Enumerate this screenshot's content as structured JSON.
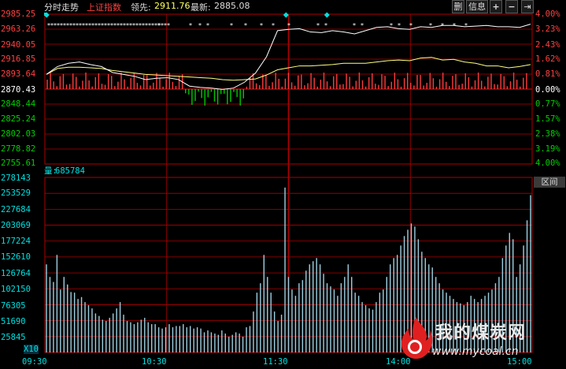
{
  "header": {
    "title": "分时走势",
    "index_name": "上证指数",
    "prev_label": "领先:",
    "prev_value": "2911.76",
    "latest_label": "最新:",
    "latest_value": "2885.08",
    "buttons": {
      "delete": "删",
      "info": "信息",
      "plus": "+",
      "minus": "−",
      "exit": "⇥"
    }
  },
  "price_axis": {
    "left": [
      "2985.25",
      "2963.26",
      "2940.05",
      "2916.85",
      "2893.64",
      "2870.43",
      "2848.44",
      "2825.24",
      "2802.03",
      "2778.82",
      "2755.61"
    ],
    "right": [
      "4.00%",
      "3.23%",
      "2.43%",
      "1.62%",
      "0.81%",
      "0.00%",
      "0.77%",
      "1.57%",
      "2.38%",
      "3.19%",
      "4.00%"
    ]
  },
  "volume": {
    "label": "量:",
    "value": "685784",
    "axis": [
      "278143",
      "253529",
      "227684",
      "203069",
      "177224",
      "152610",
      "126764",
      "102150",
      "76305",
      "51690",
      "25845"
    ],
    "multiplier": "X10"
  },
  "time_axis": [
    "09:30",
    "10:30",
    "11:30",
    "14:00",
    "15:00"
  ],
  "side_tab": "区间",
  "watermark": {
    "text": "我的煤炭网",
    "url": "www.mycoal.cn"
  },
  "colors": {
    "up": "#ff3c3c",
    "down": "#00c800",
    "price_line": "#ffffff",
    "avg_line": "#ffff80",
    "volume_bar": "#9ecfe0",
    "grid": "#b00000",
    "axis_text_up": "#ff4040",
    "axis_text_down": "#00d000",
    "cyan": "#00e0e0"
  },
  "chart_data": {
    "type": "line",
    "x": [
      "09:30",
      "10:30",
      "11:30",
      "14:00",
      "15:00"
    ],
    "price_range": [
      2755.61,
      2985.25
    ],
    "base_price": 2870.43,
    "volume_range": [
      0,
      278143
    ],
    "series": [
      {
        "values": [
          2893,
          2905,
          2910,
          2912,
          2908,
          2905,
          2896,
          2893,
          2890,
          2885,
          2887,
          2888,
          2885,
          2875,
          2873,
          2872,
          2870,
          2872,
          2881,
          2895,
          2920,
          2960,
          2962,
          2963,
          2958,
          2957,
          2960,
          2958,
          2955,
          2960,
          2965,
          2966,
          2963,
          2962,
          2966,
          2965,
          2968,
          2968,
          2966,
          2967,
          2968,
          2966,
          2966,
          2965,
          2970
        ]
      },
      {
        "values": [
          2893,
          2902,
          2904,
          2904,
          2903,
          2902,
          2899,
          2897,
          2895,
          2893,
          2892,
          2891,
          2890,
          2889,
          2888,
          2887,
          2885,
          2884,
          2885,
          2886,
          2892,
          2900,
          2903,
          2906,
          2906,
          2907,
          2908,
          2910,
          2910,
          2910,
          2912,
          2914,
          2915,
          2914,
          2918,
          2919,
          2915,
          2916,
          2912,
          2910,
          2906,
          2906,
          2903,
          2905,
          2908
        ]
      }
    ],
    "volume_bars": [
      140,
      120,
      112,
      155,
      100,
      120,
      108,
      96,
      95,
      85,
      88,
      80,
      75,
      70,
      62,
      58,
      52,
      50,
      55,
      62,
      70,
      80,
      60,
      50,
      48,
      45,
      48,
      52,
      55,
      48,
      45,
      45,
      40,
      38,
      40,
      45,
      40,
      42,
      42,
      45,
      40,
      42,
      38,
      40,
      38,
      32,
      35,
      32,
      30,
      28,
      35,
      30,
      25,
      28,
      32,
      30,
      25,
      40,
      42,
      65,
      95,
      110,
      155,
      120,
      95,
      65,
      50,
      60,
      262,
      120,
      100,
      90,
      110,
      115,
      130,
      140,
      145,
      150,
      140,
      125,
      110,
      105,
      100,
      90,
      110,
      120,
      140,
      120,
      95,
      90,
      80,
      75,
      70,
      68,
      80,
      95,
      100,
      120,
      140,
      150,
      155,
      170,
      185,
      195,
      205,
      200,
      180,
      160,
      150,
      140,
      135,
      120,
      110,
      100,
      95,
      90,
      85,
      80,
      78,
      75,
      80,
      90,
      85,
      80,
      85,
      90,
      95,
      100,
      110,
      120,
      150,
      170,
      190,
      180,
      120,
      140,
      170,
      210,
      250
    ]
  }
}
